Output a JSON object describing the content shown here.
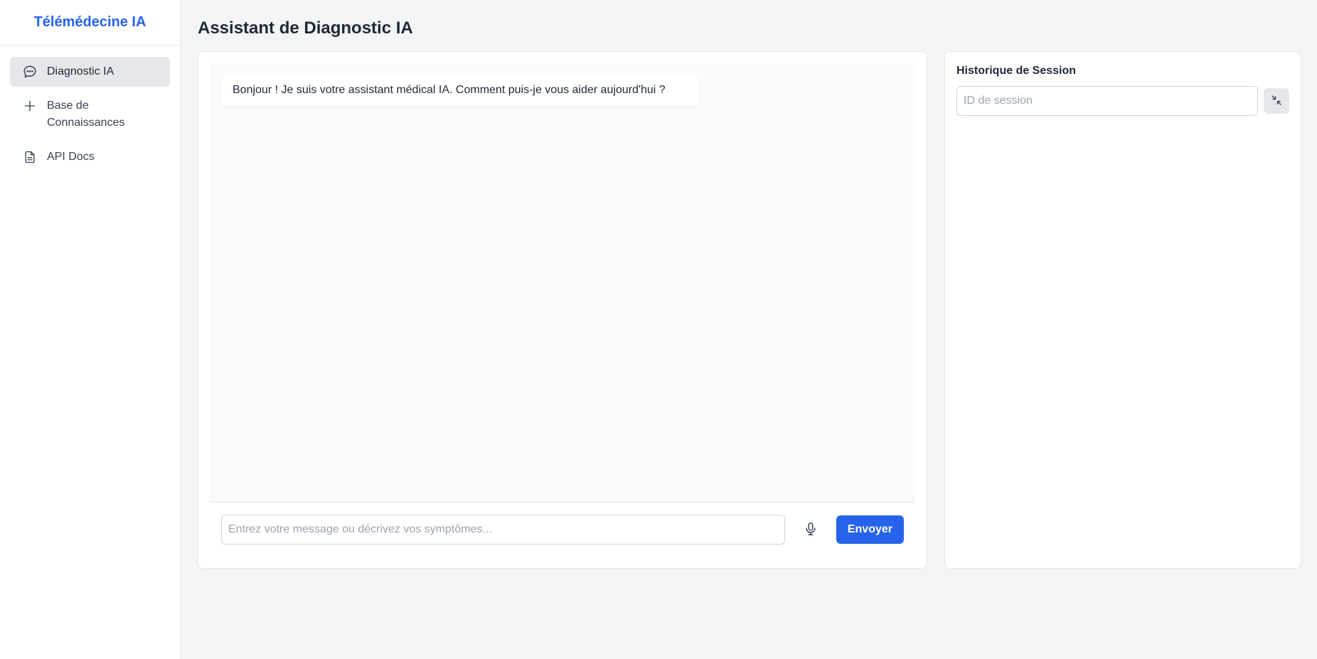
{
  "sidebar": {
    "brand": "Télémédecine IA",
    "items": [
      {
        "label": "Diagnostic IA",
        "icon": "chat-bubble-icon",
        "active": true
      },
      {
        "label": "Base de Connaissances",
        "icon": "plus-icon",
        "active": false
      },
      {
        "label": "API Docs",
        "icon": "document-icon",
        "active": false
      }
    ]
  },
  "main": {
    "title": "Assistant de Diagnostic IA"
  },
  "chat": {
    "messages": [
      {
        "role": "assistant",
        "text": "Bonjour ! Je suis votre assistant médical IA. Comment puis-je vous aider aujourd'hui ?"
      }
    ],
    "input_placeholder": "Entrez votre message ou décrivez vos symptômes...",
    "input_value": "",
    "mic_icon": "microphone-icon",
    "send_label": "Envoyer"
  },
  "history": {
    "title": "Historique de Session",
    "input_placeholder": "ID de session",
    "input_value": "",
    "load_icon": "collapse-arrows-icon"
  },
  "colors": {
    "accent": "#2563eb",
    "background": "#f3f4f6",
    "active_nav": "#e5e7eb"
  }
}
